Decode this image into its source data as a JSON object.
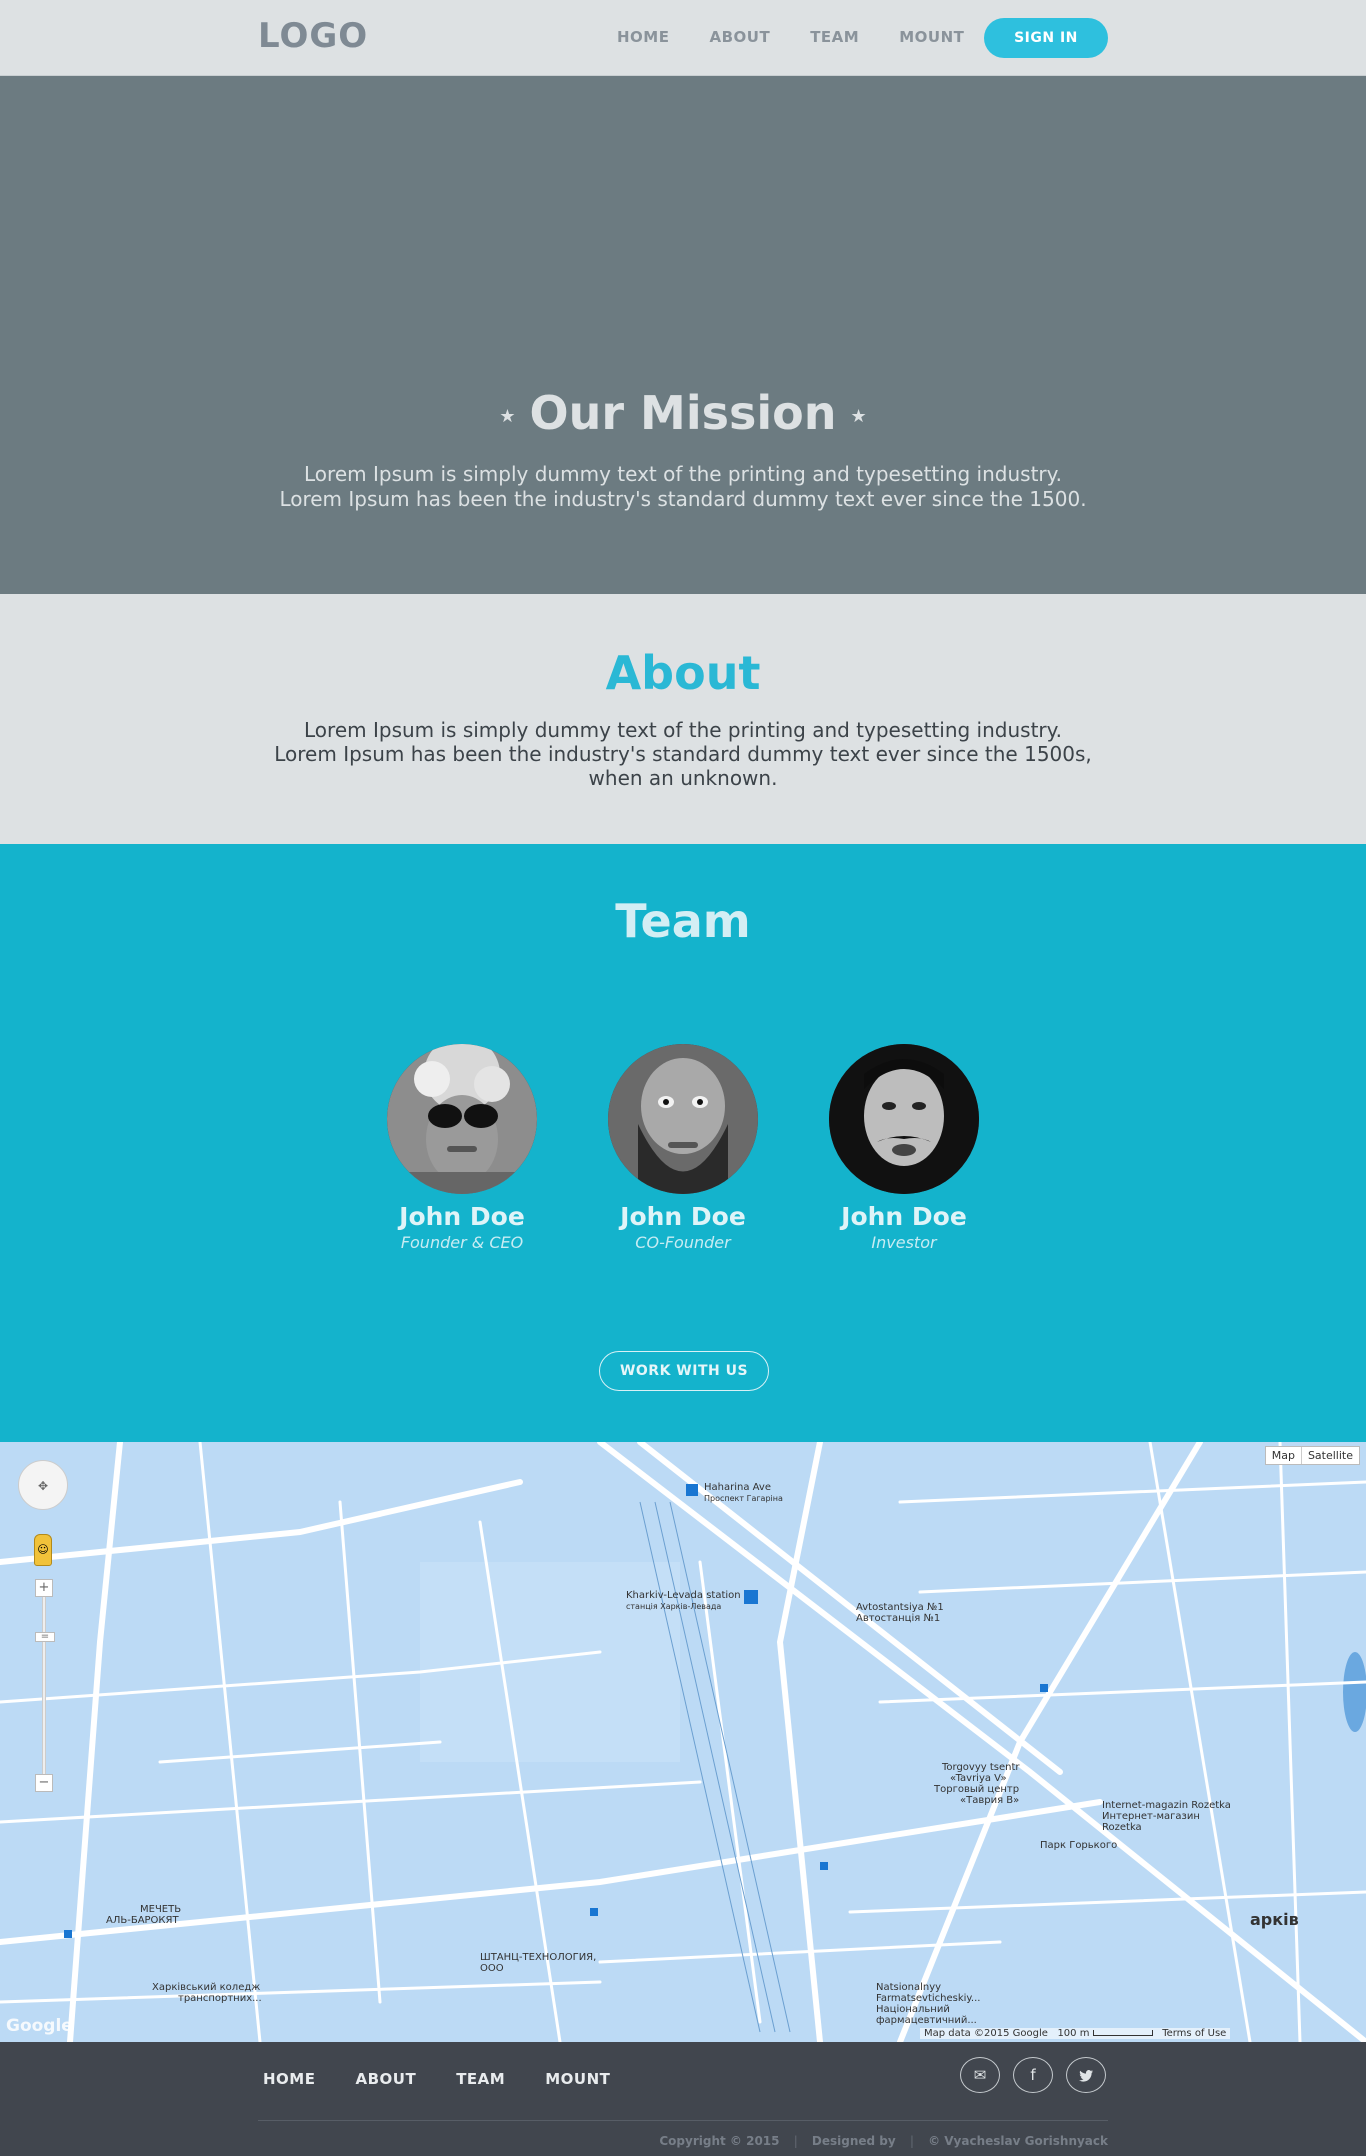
{
  "header": {
    "logo": "LOGO",
    "nav": [
      "HOME",
      "ABOUT",
      "TEAM",
      "MOUNT"
    ],
    "signin": "SIGN IN"
  },
  "mission": {
    "title": "Our Mission",
    "star": "★",
    "line1": "Lorem Ipsum is simply dummy text of the printing and typesetting industry.",
    "line2": "Lorem Ipsum has been the industry's standard dummy text ever since the 1500."
  },
  "about": {
    "title": "About",
    "line1": "Lorem Ipsum is simply dummy text of the printing and typesetting industry.",
    "line2": "Lorem Ipsum has been the industry's standard dummy text ever since the 1500s,",
    "line3": "when an unknown."
  },
  "team": {
    "title": "Team",
    "members": [
      {
        "name": "John Doe",
        "role": "Founder & CEO"
      },
      {
        "name": "John Doe",
        "role": "CO-Founder"
      },
      {
        "name": "John Doe",
        "role": "Investor"
      }
    ],
    "cta": "WORK WITH US"
  },
  "map": {
    "type_options": [
      "Map",
      "Satellite"
    ],
    "labels": [
      "Haharina Ave",
      "Проспект Гагаріна",
      "Kharkiv-Levada station",
      "станція Харків-Левада",
      "Avtostantsiya №1",
      "Автостанція №1",
      "Torgovyy tsentr",
      "«Tavriya V»",
      "Торговый центр",
      "«Таврия В»",
      "Internet-magazin Rozetka",
      "Интернет-магазин",
      "Rozetka",
      "Парк Горького",
      "МЕЧЕТЬ",
      "АЛЬ-БАРОКЯТ",
      "ШТАНЦ-ТЕХНОЛОГИЯ,",
      "ООО",
      "Харківський коледж",
      "транспортних...",
      "Natsionalnyy",
      "Farmatsevticheskiy...",
      "Національний",
      "фармацевтичний...",
      "арків"
    ],
    "attribution": "Map data ©2015 Google",
    "scale": "100 m",
    "terms": "Terms of Use",
    "google": "Google"
  },
  "footer": {
    "nav": [
      "HOME",
      "ABOUT",
      "TEAM",
      "MOUNT"
    ],
    "social_icons": [
      "mail-icon",
      "facebook-icon",
      "twitter-icon"
    ],
    "copyright": "Copyright © 2015",
    "designed_by": "Designed by",
    "author": "© Vyacheslav Gorishnyack",
    "separator": "|"
  },
  "colors": {
    "accent": "#2ec0de",
    "mission_bg": "#6c7b81",
    "team_bg": "#14b3cc",
    "footer_bg": "#41464e",
    "map_bg": "#b9d9f5"
  }
}
